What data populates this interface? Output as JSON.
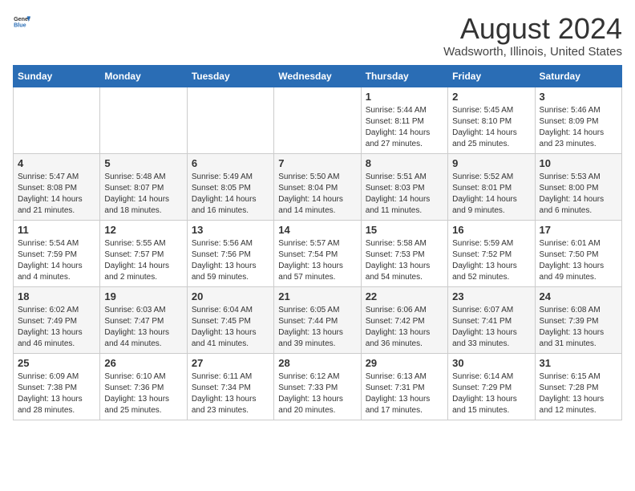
{
  "app": {
    "name_general": "General",
    "name_blue": "Blue"
  },
  "header": {
    "title": "August 2024",
    "subtitle": "Wadsworth, Illinois, United States"
  },
  "calendar": {
    "days_of_week": [
      "Sunday",
      "Monday",
      "Tuesday",
      "Wednesday",
      "Thursday",
      "Friday",
      "Saturday"
    ],
    "weeks": [
      [
        {
          "date": "",
          "info": ""
        },
        {
          "date": "",
          "info": ""
        },
        {
          "date": "",
          "info": ""
        },
        {
          "date": "",
          "info": ""
        },
        {
          "date": "1",
          "info": "Sunrise: 5:44 AM\nSunset: 8:11 PM\nDaylight: 14 hours and 27 minutes."
        },
        {
          "date": "2",
          "info": "Sunrise: 5:45 AM\nSunset: 8:10 PM\nDaylight: 14 hours and 25 minutes."
        },
        {
          "date": "3",
          "info": "Sunrise: 5:46 AM\nSunset: 8:09 PM\nDaylight: 14 hours and 23 minutes."
        }
      ],
      [
        {
          "date": "4",
          "info": "Sunrise: 5:47 AM\nSunset: 8:08 PM\nDaylight: 14 hours and 21 minutes."
        },
        {
          "date": "5",
          "info": "Sunrise: 5:48 AM\nSunset: 8:07 PM\nDaylight: 14 hours and 18 minutes."
        },
        {
          "date": "6",
          "info": "Sunrise: 5:49 AM\nSunset: 8:05 PM\nDaylight: 14 hours and 16 minutes."
        },
        {
          "date": "7",
          "info": "Sunrise: 5:50 AM\nSunset: 8:04 PM\nDaylight: 14 hours and 14 minutes."
        },
        {
          "date": "8",
          "info": "Sunrise: 5:51 AM\nSunset: 8:03 PM\nDaylight: 14 hours and 11 minutes."
        },
        {
          "date": "9",
          "info": "Sunrise: 5:52 AM\nSunset: 8:01 PM\nDaylight: 14 hours and 9 minutes."
        },
        {
          "date": "10",
          "info": "Sunrise: 5:53 AM\nSunset: 8:00 PM\nDaylight: 14 hours and 6 minutes."
        }
      ],
      [
        {
          "date": "11",
          "info": "Sunrise: 5:54 AM\nSunset: 7:59 PM\nDaylight: 14 hours and 4 minutes."
        },
        {
          "date": "12",
          "info": "Sunrise: 5:55 AM\nSunset: 7:57 PM\nDaylight: 14 hours and 2 minutes."
        },
        {
          "date": "13",
          "info": "Sunrise: 5:56 AM\nSunset: 7:56 PM\nDaylight: 13 hours and 59 minutes."
        },
        {
          "date": "14",
          "info": "Sunrise: 5:57 AM\nSunset: 7:54 PM\nDaylight: 13 hours and 57 minutes."
        },
        {
          "date": "15",
          "info": "Sunrise: 5:58 AM\nSunset: 7:53 PM\nDaylight: 13 hours and 54 minutes."
        },
        {
          "date": "16",
          "info": "Sunrise: 5:59 AM\nSunset: 7:52 PM\nDaylight: 13 hours and 52 minutes."
        },
        {
          "date": "17",
          "info": "Sunrise: 6:01 AM\nSunset: 7:50 PM\nDaylight: 13 hours and 49 minutes."
        }
      ],
      [
        {
          "date": "18",
          "info": "Sunrise: 6:02 AM\nSunset: 7:49 PM\nDaylight: 13 hours and 46 minutes."
        },
        {
          "date": "19",
          "info": "Sunrise: 6:03 AM\nSunset: 7:47 PM\nDaylight: 13 hours and 44 minutes."
        },
        {
          "date": "20",
          "info": "Sunrise: 6:04 AM\nSunset: 7:45 PM\nDaylight: 13 hours and 41 minutes."
        },
        {
          "date": "21",
          "info": "Sunrise: 6:05 AM\nSunset: 7:44 PM\nDaylight: 13 hours and 39 minutes."
        },
        {
          "date": "22",
          "info": "Sunrise: 6:06 AM\nSunset: 7:42 PM\nDaylight: 13 hours and 36 minutes."
        },
        {
          "date": "23",
          "info": "Sunrise: 6:07 AM\nSunset: 7:41 PM\nDaylight: 13 hours and 33 minutes."
        },
        {
          "date": "24",
          "info": "Sunrise: 6:08 AM\nSunset: 7:39 PM\nDaylight: 13 hours and 31 minutes."
        }
      ],
      [
        {
          "date": "25",
          "info": "Sunrise: 6:09 AM\nSunset: 7:38 PM\nDaylight: 13 hours and 28 minutes."
        },
        {
          "date": "26",
          "info": "Sunrise: 6:10 AM\nSunset: 7:36 PM\nDaylight: 13 hours and 25 minutes."
        },
        {
          "date": "27",
          "info": "Sunrise: 6:11 AM\nSunset: 7:34 PM\nDaylight: 13 hours and 23 minutes."
        },
        {
          "date": "28",
          "info": "Sunrise: 6:12 AM\nSunset: 7:33 PM\nDaylight: 13 hours and 20 minutes."
        },
        {
          "date": "29",
          "info": "Sunrise: 6:13 AM\nSunset: 7:31 PM\nDaylight: 13 hours and 17 minutes."
        },
        {
          "date": "30",
          "info": "Sunrise: 6:14 AM\nSunset: 7:29 PM\nDaylight: 13 hours and 15 minutes."
        },
        {
          "date": "31",
          "info": "Sunrise: 6:15 AM\nSunset: 7:28 PM\nDaylight: 13 hours and 12 minutes."
        }
      ]
    ]
  }
}
